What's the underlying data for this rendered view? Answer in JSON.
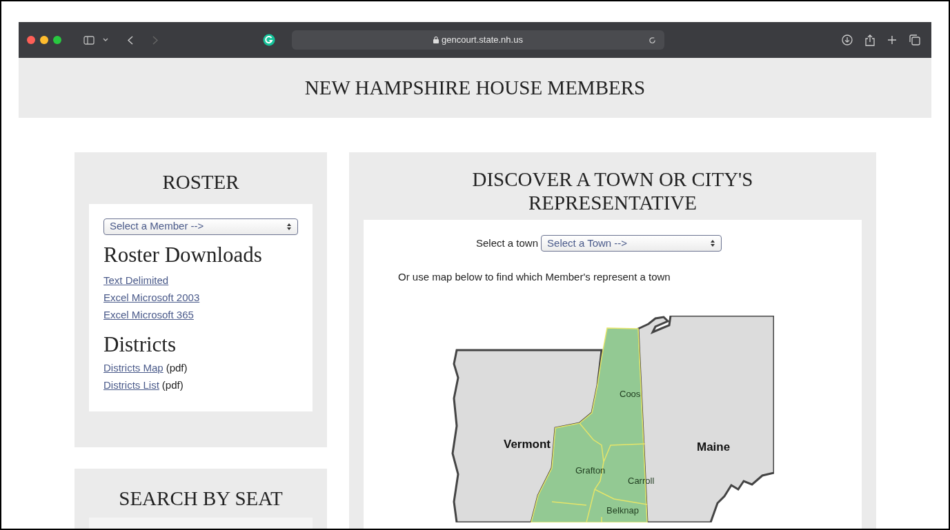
{
  "browser": {
    "address": "gencourt.state.nh.us"
  },
  "header": {
    "title": "NEW HAMPSHIRE HOUSE MEMBERS"
  },
  "roster": {
    "title": "ROSTER",
    "member_select": "Select a Member -->",
    "downloads_title": "Roster Downloads",
    "downloads": [
      {
        "label": "Text Delimited"
      },
      {
        "label": "Excel Microsoft 2003"
      },
      {
        "label": "Excel Microsoft 365"
      }
    ],
    "districts_title": "Districts",
    "districts": [
      {
        "label": "Districts Map",
        "note": "(pdf)"
      },
      {
        "label": "Districts List",
        "note": "(pdf)"
      }
    ]
  },
  "search_by_seat": {
    "title": "SEARCH BY SEAT"
  },
  "discover": {
    "title": "DISCOVER A TOWN OR CITY'S REPRESENTATIVE",
    "town_label": "Select a town",
    "town_select": "Select a Town -->",
    "hint": "Or use map below to find which Member's represent a town",
    "map_labels": [
      {
        "text": "Vermont",
        "kind": "state"
      },
      {
        "text": "Maine",
        "kind": "state"
      },
      {
        "text": "Coos",
        "kind": "county"
      },
      {
        "text": "Grafton",
        "kind": "county"
      },
      {
        "text": "Carroll",
        "kind": "county"
      },
      {
        "text": "Belknap",
        "kind": "county"
      }
    ]
  }
}
